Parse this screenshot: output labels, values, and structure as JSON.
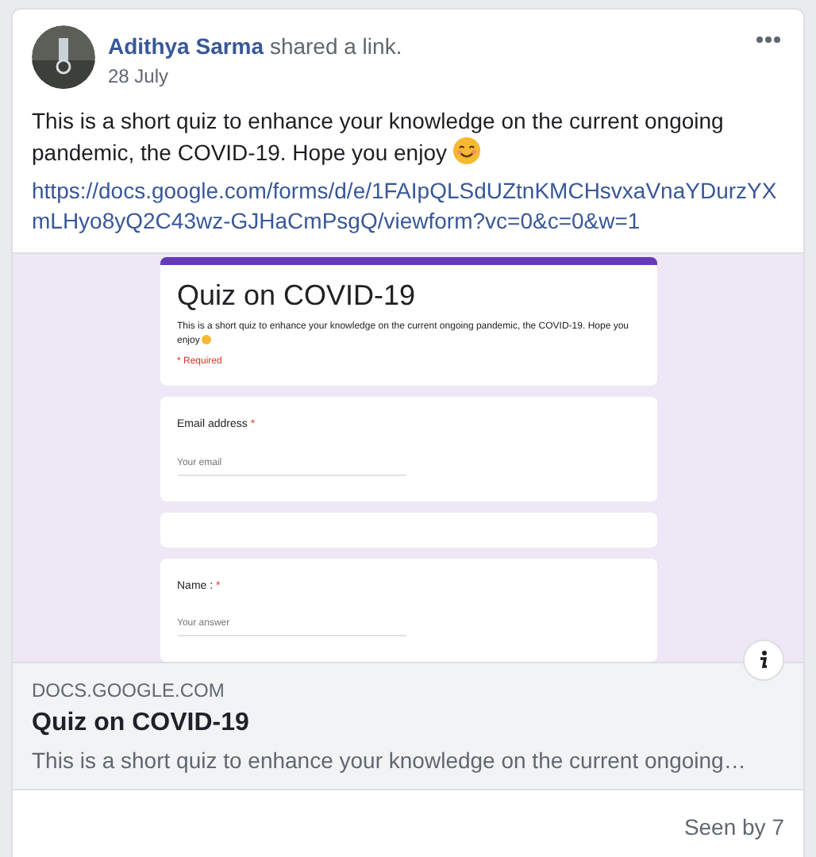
{
  "post": {
    "author": "Adithya Sarma",
    "action": "shared a link.",
    "date": "28 July",
    "text": "This is a short quiz to enhance your knowledge on the current ongoing pandemic, the COVID-19. Hope you enjoy",
    "link": "https://docs.google.com/forms/d/e/1FAIpQLSdUZtnKMCHsvxaVnaYDurzYXmLHyo8yQ2C43wz-GJHaCmPsgQ/viewform?vc=0&c=0&w=1"
  },
  "form_preview": {
    "title": "Quiz on COVID-19",
    "description": "This is a short quiz to enhance your knowledge on the current ongoing pandemic, the COVID-19. Hope you enjoy",
    "required_note": "* Required",
    "questions": [
      {
        "kind": "field",
        "label": "Email address",
        "required_mark": "*",
        "placeholder": "Your email"
      },
      {
        "kind": "blank"
      },
      {
        "kind": "field",
        "label": "Name :",
        "required_mark": "*",
        "placeholder": "Your answer"
      }
    ]
  },
  "link_card": {
    "domain": "DOCS.GOOGLE.COM",
    "title": "Quiz on COVID-19",
    "description": "This is a short quiz to enhance your knowledge on the current ongoing…"
  },
  "footer": {
    "seen": "Seen by 7"
  }
}
